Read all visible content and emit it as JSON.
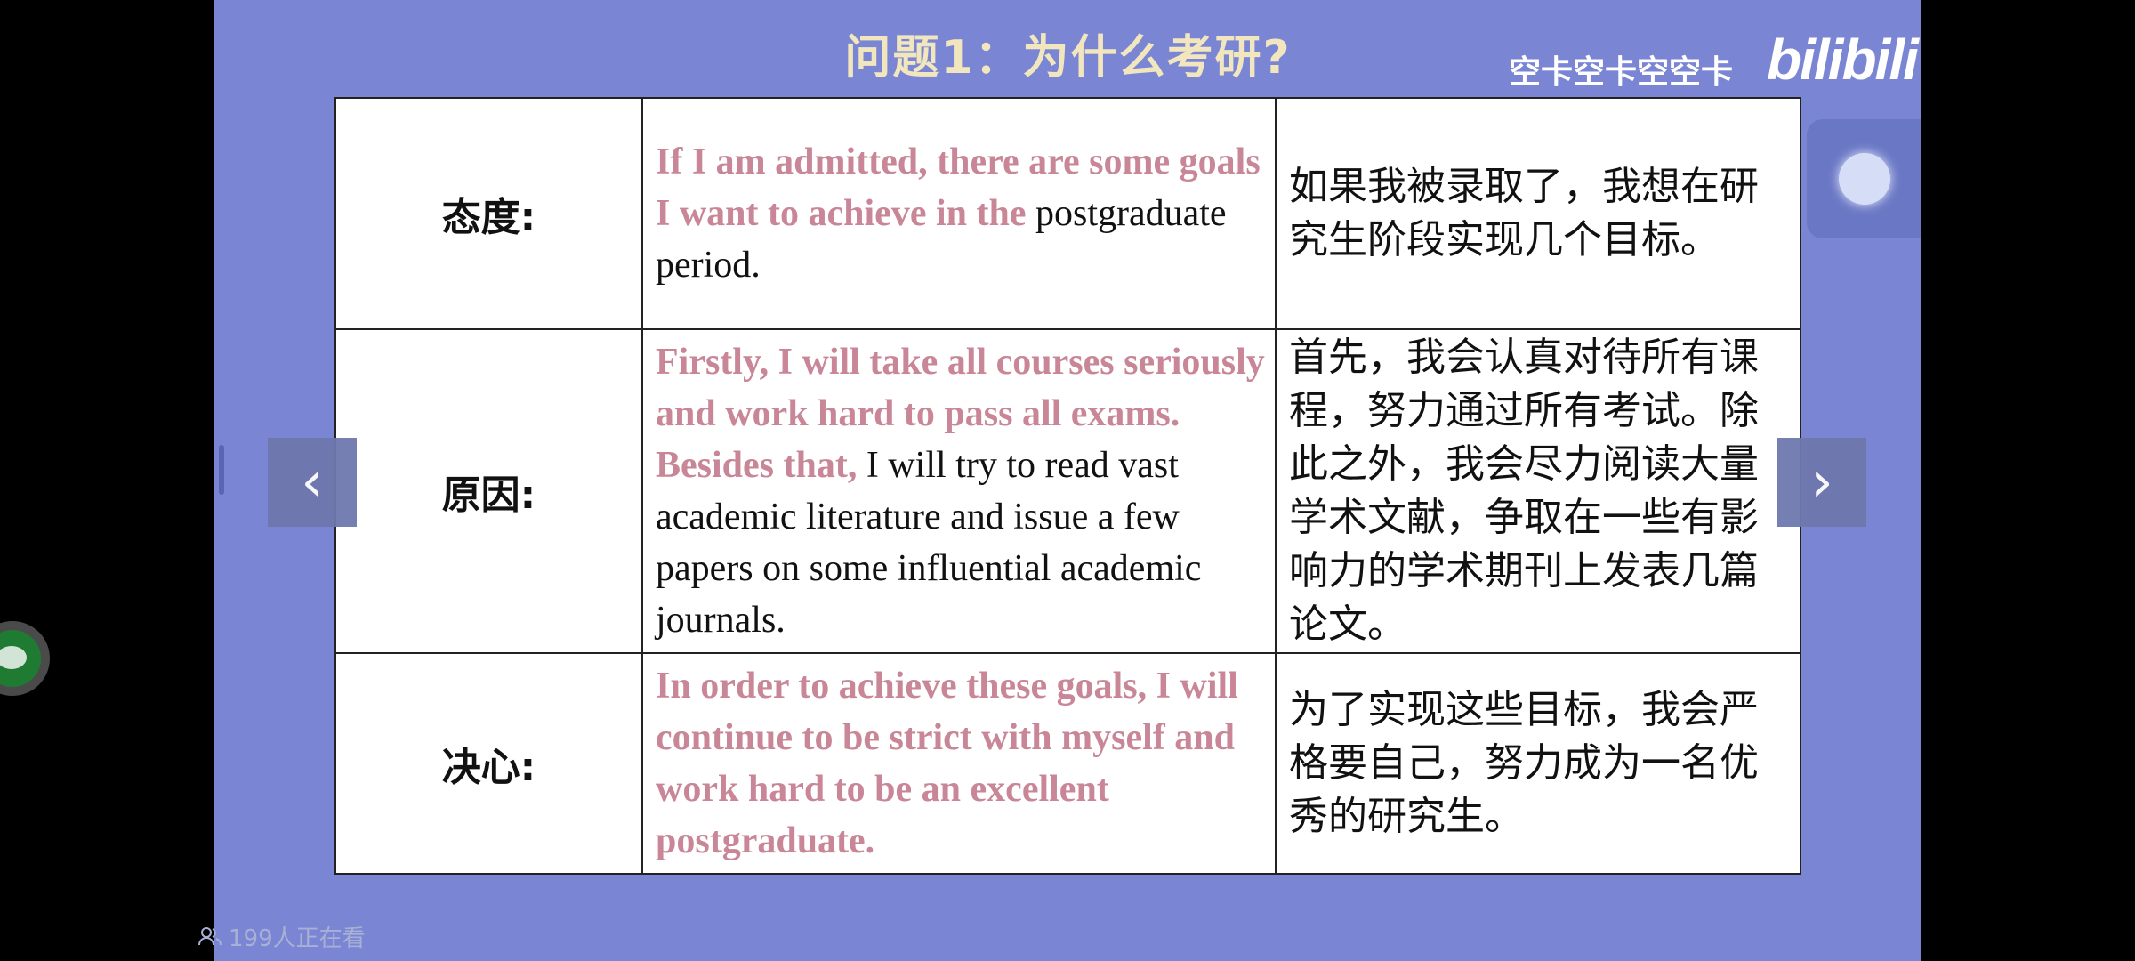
{
  "slide": {
    "title": "问题1：为什么考研?",
    "uploader": "空卡空卡空空卡",
    "logo": "bilibili"
  },
  "table": {
    "rows": [
      {
        "label": "态度:",
        "en_highlight": "If I am admitted, there are some goals I want to achieve in the",
        "en_plain": " postgraduate period.",
        "zh": "如果我被录取了，我想在研究生阶段实现几个目标。"
      },
      {
        "label": "原因:",
        "en_highlight": "Firstly, I will take all courses seriously and work hard to pass all exams. Besides that,",
        "en_plain": " I will try to read vast academic literature and issue a few papers on some influential academic journals.",
        "zh": "首先，我会认真对待所有课程，努力通过所有考试。除此之外，我会尽力阅读大量学术文献，争取在一些有影响力的学术期刊上发表几篇论文。"
      },
      {
        "label": "决心:",
        "en_highlight": "In order to achieve these goals, I will continue to be strict with myself and work hard to be an excellent postgraduate.",
        "en_plain": "",
        "zh": "为了实现这些目标，我会严格要自己，努力成为一名优秀的研究生。"
      }
    ]
  },
  "controls": {
    "prev_icon": "‹",
    "next_icon": "›"
  },
  "viewers": "199人正在看",
  "colors": {
    "slide_bg": "#7a86d4",
    "highlight": "#c88697",
    "title": "#f1e6bd"
  }
}
